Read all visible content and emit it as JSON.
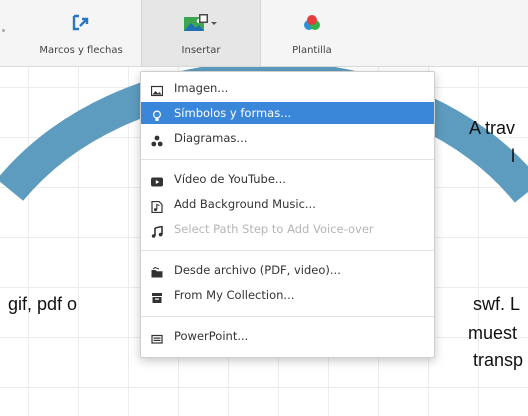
{
  "toolbar": {
    "marcos_label": "Marcos y flechas",
    "insertar_label": "Insertar",
    "plantilla_label": "Plantilla"
  },
  "menu": {
    "items": [
      {
        "label": "Imagen...",
        "icon": "image-icon"
      },
      {
        "label": "Símbolos y formas...",
        "icon": "lightbulb-icon",
        "selected": true
      },
      {
        "label": "Diagramas...",
        "icon": "diagram-icon"
      },
      {
        "label": "Vídeo de YouTube...",
        "icon": "youtube-icon"
      },
      {
        "label": "Add Background Music...",
        "icon": "music-file-icon"
      },
      {
        "label": "Select Path Step to Add Voice-over",
        "icon": "music-note-icon",
        "disabled": true
      },
      {
        "label": "Desde archivo (PDF, video)...",
        "icon": "folder-icon"
      },
      {
        "label": "From My Collection...",
        "icon": "collection-icon"
      },
      {
        "label": "PowerPoint...",
        "icon": "powerpoint-icon"
      }
    ]
  },
  "canvas": {
    "text_right_1": "A trav",
    "text_right_2": "l",
    "text_left": "gif, pdf o",
    "text_right_3": "swf. L",
    "text_right_4": "muest",
    "text_right_5": "transp"
  },
  "colors": {
    "accent": "#3a87d9",
    "arc": "#5e9cbf",
    "toolbar_bg": "#f5f5f5"
  }
}
